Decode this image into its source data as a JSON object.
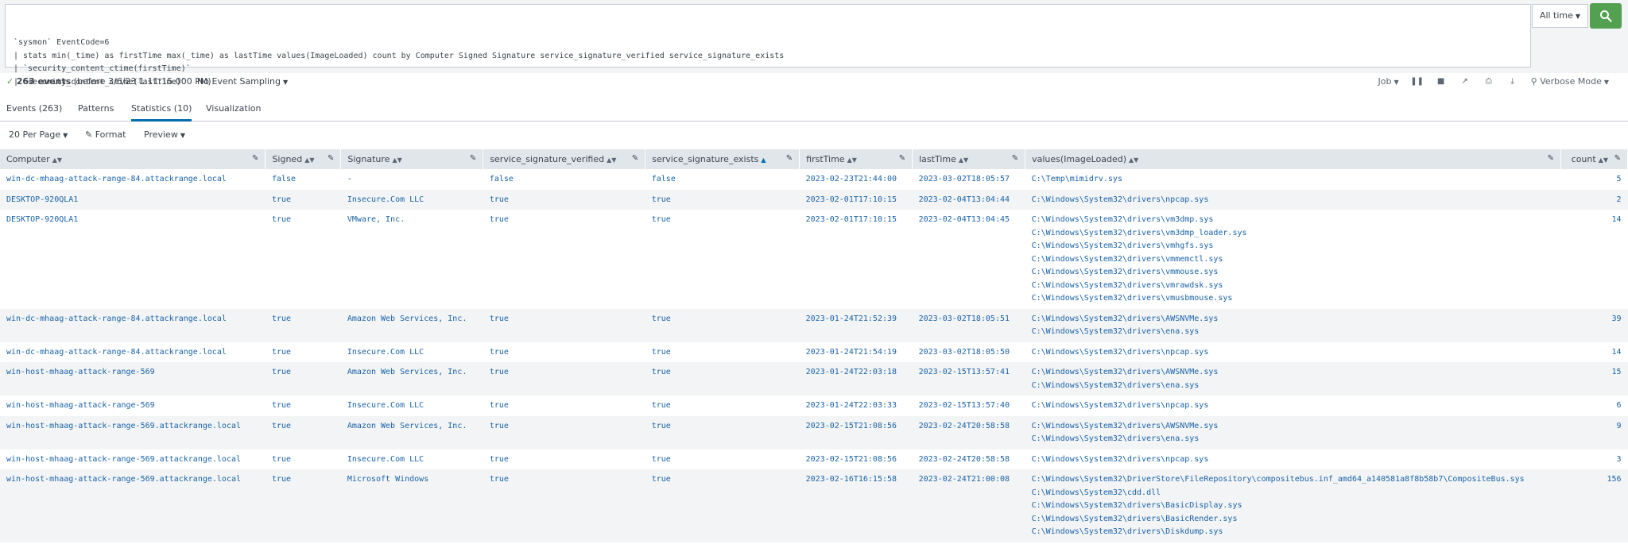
{
  "search": {
    "lines": [
      "`sysmon` EventCode=6",
      "| stats min(_time) as firstTime max(_time) as lastTime values(ImageLoaded) count by Computer Signed Signature service_signature_verified service_signature_exists",
      "| `security_content_ctime(firstTime)`",
      "| `security_content_ctime(lastTime)`"
    ],
    "time_range": "All time"
  },
  "status": {
    "events_bold": "263 events",
    "events_rest": "(before 3/6/23 1:11:15.000 PM)",
    "sampling": "No Event Sampling",
    "job": "Job",
    "mode": "Verbose Mode"
  },
  "tabs": [
    {
      "label": "Events (263)"
    },
    {
      "label": "Patterns"
    },
    {
      "label": "Statistics (10)"
    },
    {
      "label": "Visualization"
    }
  ],
  "toolbar": {
    "per_page": "20 Per Page",
    "format": "Format",
    "preview": "Preview"
  },
  "columns": [
    "Computer",
    "Signed",
    "Signature",
    "service_signature_verified",
    "service_signature_exists",
    "firstTime",
    "lastTime",
    "values(ImageLoaded)",
    "count"
  ],
  "rows": [
    {
      "computer": "win-dc-mhaag-attack-range-84.attackrange.local",
      "signed": "false",
      "signature": "-",
      "verified": "false",
      "exists": "false",
      "first": "2023-02-23T21:44:00",
      "last": "2023-03-02T18:05:57",
      "images": [
        "C:\\Temp\\mimidrv.sys"
      ],
      "count": "5"
    },
    {
      "computer": "DESKTOP-920QLA1",
      "signed": "true",
      "signature": "Insecure.Com LLC",
      "verified": "true",
      "exists": "true",
      "first": "2023-02-01T17:10:15",
      "last": "2023-02-04T13:04:44",
      "images": [
        "C:\\Windows\\System32\\drivers\\npcap.sys"
      ],
      "count": "2"
    },
    {
      "computer": "DESKTOP-920QLA1",
      "signed": "true",
      "signature": "VMware, Inc.",
      "verified": "true",
      "exists": "true",
      "first": "2023-02-01T17:10:15",
      "last": "2023-02-04T13:04:45",
      "images": [
        "C:\\Windows\\System32\\drivers\\vm3dmp.sys",
        "C:\\Windows\\System32\\drivers\\vm3dmp_loader.sys",
        "C:\\Windows\\System32\\drivers\\vmhgfs.sys",
        "C:\\Windows\\System32\\drivers\\vmmemctl.sys",
        "C:\\Windows\\System32\\drivers\\vmmouse.sys",
        "C:\\Windows\\System32\\drivers\\vmrawdsk.sys",
        "C:\\Windows\\System32\\drivers\\vmusbmouse.sys"
      ],
      "count": "14"
    },
    {
      "computer": "win-dc-mhaag-attack-range-84.attackrange.local",
      "signed": "true",
      "signature": "Amazon Web Services, Inc.",
      "verified": "true",
      "exists": "true",
      "first": "2023-01-24T21:52:39",
      "last": "2023-03-02T18:05:51",
      "images": [
        "C:\\Windows\\System32\\drivers\\AWSNVMe.sys",
        "C:\\Windows\\System32\\drivers\\ena.sys"
      ],
      "count": "39"
    },
    {
      "computer": "win-dc-mhaag-attack-range-84.attackrange.local",
      "signed": "true",
      "signature": "Insecure.Com LLC",
      "verified": "true",
      "exists": "true",
      "first": "2023-01-24T21:54:19",
      "last": "2023-03-02T18:05:50",
      "images": [
        "C:\\Windows\\System32\\drivers\\npcap.sys"
      ],
      "count": "14"
    },
    {
      "computer": "win-host-mhaag-attack-range-569",
      "signed": "true",
      "signature": "Amazon Web Services, Inc.",
      "verified": "true",
      "exists": "true",
      "first": "2023-01-24T22:03:18",
      "last": "2023-02-15T13:57:41",
      "images": [
        "C:\\Windows\\System32\\drivers\\AWSNVMe.sys",
        "C:\\Windows\\System32\\drivers\\ena.sys"
      ],
      "count": "15"
    },
    {
      "computer": "win-host-mhaag-attack-range-569",
      "signed": "true",
      "signature": "Insecure.Com LLC",
      "verified": "true",
      "exists": "true",
      "first": "2023-01-24T22:03:33",
      "last": "2023-02-15T13:57:40",
      "images": [
        "C:\\Windows\\System32\\drivers\\npcap.sys"
      ],
      "count": "6"
    },
    {
      "computer": "win-host-mhaag-attack-range-569.attackrange.local",
      "signed": "true",
      "signature": "Amazon Web Services, Inc.",
      "verified": "true",
      "exists": "true",
      "first": "2023-02-15T21:08:56",
      "last": "2023-02-24T20:58:58",
      "images": [
        "C:\\Windows\\System32\\drivers\\AWSNVMe.sys",
        "C:\\Windows\\System32\\drivers\\ena.sys"
      ],
      "count": "9"
    },
    {
      "computer": "win-host-mhaag-attack-range-569.attackrange.local",
      "signed": "true",
      "signature": "Insecure.Com LLC",
      "verified": "true",
      "exists": "true",
      "first": "2023-02-15T21:08:56",
      "last": "2023-02-24T20:58:58",
      "images": [
        "C:\\Windows\\System32\\drivers\\npcap.sys"
      ],
      "count": "3"
    },
    {
      "computer": "win-host-mhaag-attack-range-569.attackrange.local",
      "signed": "true",
      "signature": "Microsoft Windows",
      "verified": "true",
      "exists": "true",
      "first": "2023-02-16T16:15:58",
      "last": "2023-02-24T21:00:08",
      "images": [
        "C:\\Windows\\System32\\DriverStore\\FileRepository\\compositebus.inf_amd64_a140581a8f8b58b7\\CompositeBus.sys",
        "C:\\Windows\\System32\\cdd.dll",
        "C:\\Windows\\System32\\drivers\\BasicDisplay.sys",
        "C:\\Windows\\System32\\drivers\\BasicRender.sys",
        "C:\\Windows\\System32\\drivers\\Diskdump.sys"
      ],
      "count": "156"
    }
  ],
  "colors": {
    "accent": "#006eaa",
    "link": "#1a62a8",
    "search_green": "#53a051",
    "header_bg": "#e1e6eb"
  }
}
